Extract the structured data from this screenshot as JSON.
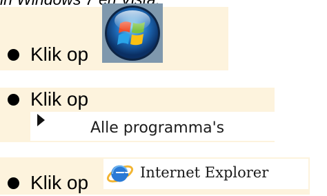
{
  "header": {
    "text": "in Windows 7 en Vista:"
  },
  "steps": [
    {
      "bullet_text": "Klik op",
      "target": "windows-start-orb"
    },
    {
      "bullet_text": "Klik op",
      "target": "all-programs-menu-item",
      "menu_label": "Alle programma's"
    },
    {
      "bullet_text": "Klik op",
      "target": "internet-explorer-menu-item",
      "menu_label": "Internet Explorer"
    }
  ],
  "colors": {
    "band_background": "#fdf3dd",
    "bullet": "#000000",
    "orb_background": "#7f98ad",
    "ie_blue": "#2a7ad6",
    "ie_gold": "#f2b533"
  },
  "icons": [
    "windows-logo-icon",
    "menu-arrow-icon",
    "internet-explorer-icon"
  ]
}
